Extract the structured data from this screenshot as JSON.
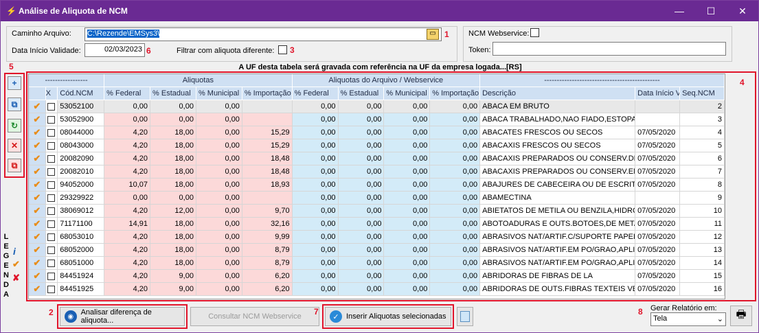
{
  "window": {
    "title": "Análise de Aliquota de NCM",
    "controls": [
      "—",
      "☐",
      "✕"
    ]
  },
  "form": {
    "caminho_label": "Caminho Arquivo:",
    "caminho_value": "C:\\Rezende\\EMSys3\\",
    "data_label": "Data Início Validade:",
    "data_value": "02/03/2023",
    "filtrar_label": "Filtrar com aliquota diferente:",
    "ncm_ws_label": "NCM Webservice:",
    "token_label": "Token:",
    "token_value": ""
  },
  "notice": "A UF desta tabela será gravada com referência na UF da empresa logada...[RS]",
  "markers": {
    "m1": "1",
    "m2": "2",
    "m3": "3",
    "m4": "4",
    "m5": "5",
    "m6": "6",
    "m7": "7",
    "m8": "8"
  },
  "grid": {
    "group_headers": [
      "-----------------",
      "Aliquotas",
      "Aliquotas do Arquivo / Webservice",
      "----------------------------------------------"
    ],
    "columns": [
      "",
      "X",
      "Cód.NCM",
      "% Federal",
      "% Estadual",
      "% Municipal",
      "% Importação",
      "% Federal",
      "% Estadual",
      "% Municipal",
      "% Importação",
      "Descrição",
      "Data Início Va",
      "Seq.NCM"
    ],
    "rows": [
      {
        "ncm": "53052100",
        "f": "0,00",
        "e": "0,00",
        "m": "0,00",
        "i": "",
        "wf": "0,00",
        "we": "0,00",
        "wm": "0,00",
        "wi": "0,00",
        "desc": "ABACA EM BRUTO",
        "date": "",
        "seq": "2"
      },
      {
        "ncm": "53052900",
        "f": "0,00",
        "e": "0,00",
        "m": "0,00",
        "i": "",
        "wf": "0,00",
        "we": "0,00",
        "wm": "0,00",
        "wi": "0,00",
        "desc": "ABACA TRABALHADO,NAO FIADO,ESTOPAS E",
        "date": "",
        "seq": "3"
      },
      {
        "ncm": "08044000",
        "f": "4,20",
        "e": "18,00",
        "m": "0,00",
        "i": "15,29",
        "wf": "0,00",
        "we": "0,00",
        "wm": "0,00",
        "wi": "0,00",
        "desc": "ABACATES FRESCOS OU SECOS",
        "date": "07/05/2020",
        "seq": "4"
      },
      {
        "ncm": "08043000",
        "f": "4,20",
        "e": "18,00",
        "m": "0,00",
        "i": "15,29",
        "wf": "0,00",
        "we": "0,00",
        "wm": "0,00",
        "wi": "0,00",
        "desc": "ABACAXIS FRESCOS OU SECOS",
        "date": "07/05/2020",
        "seq": "5"
      },
      {
        "ncm": "20082090",
        "f": "4,20",
        "e": "18,00",
        "m": "0,00",
        "i": "18,48",
        "wf": "0,00",
        "we": "0,00",
        "wm": "0,00",
        "wi": "0,00",
        "desc": "ABACAXIS PREPARADOS OU CONSERV.DE OUT",
        "date": "07/05/2020",
        "seq": "6"
      },
      {
        "ncm": "20082010",
        "f": "4,20",
        "e": "18,00",
        "m": "0,00",
        "i": "18,48",
        "wf": "0,00",
        "we": "0,00",
        "wm": "0,00",
        "wi": "0,00",
        "desc": "ABACAXIS PREPARADOS OU CONSERV.EM AGU",
        "date": "07/05/2020",
        "seq": "7"
      },
      {
        "ncm": "94052000",
        "f": "10,07",
        "e": "18,00",
        "m": "0,00",
        "i": "18,93",
        "wf": "0,00",
        "we": "0,00",
        "wm": "0,00",
        "wi": "0,00",
        "desc": "ABAJURES DE CABECEIRA OU DE ESCRITORIC",
        "date": "07/05/2020",
        "seq": "8"
      },
      {
        "ncm": "29329922",
        "f": "0,00",
        "e": "0,00",
        "m": "0,00",
        "i": "",
        "wf": "0,00",
        "we": "0,00",
        "wm": "0,00",
        "wi": "0,00",
        "desc": "ABAMECTINA",
        "date": "",
        "seq": "9"
      },
      {
        "ncm": "38069012",
        "f": "4,20",
        "e": "12,00",
        "m": "0,00",
        "i": "9,70",
        "wf": "0,00",
        "we": "0,00",
        "wm": "0,00",
        "wi": "0,00",
        "desc": "ABIETATOS DE METILA OU BENZILA,HIDROABI",
        "date": "07/05/2020",
        "seq": "10"
      },
      {
        "ncm": "71171100",
        "f": "14,91",
        "e": "18,00",
        "m": "0,00",
        "i": "32,16",
        "wf": "0,00",
        "we": "0,00",
        "wm": "0,00",
        "wi": "0,00",
        "desc": "ABOTOADURAS E OUTS.BOTOES,DE METAIS C",
        "date": "07/05/2020",
        "seq": "11"
      },
      {
        "ncm": "68053010",
        "f": "4,20",
        "e": "18,00",
        "m": "0,00",
        "i": "9,99",
        "wf": "0,00",
        "we": "0,00",
        "wm": "0,00",
        "wi": "0,00",
        "desc": "ABRASIVOS NAT/ARTIF.C/SUPORTE PAPEL/CA",
        "date": "07/05/2020",
        "seq": "12"
      },
      {
        "ncm": "68052000",
        "f": "4,20",
        "e": "18,00",
        "m": "0,00",
        "i": "8,79",
        "wf": "0,00",
        "we": "0,00",
        "wm": "0,00",
        "wi": "0,00",
        "desc": "ABRASIVOS NAT/ARTIF.EM PO/GRAO,APLIC.E",
        "date": "07/05/2020",
        "seq": "13"
      },
      {
        "ncm": "68051000",
        "f": "4,20",
        "e": "18,00",
        "m": "0,00",
        "i": "8,79",
        "wf": "0,00",
        "we": "0,00",
        "wm": "0,00",
        "wi": "0,00",
        "desc": "ABRASIVOS NAT/ARTIF.EM PO/GRAO,APLIC.E",
        "date": "07/05/2020",
        "seq": "14"
      },
      {
        "ncm": "84451924",
        "f": "4,20",
        "e": "9,00",
        "m": "0,00",
        "i": "6,20",
        "wf": "0,00",
        "we": "0,00",
        "wm": "0,00",
        "wi": "0,00",
        "desc": "ABRIDORAS DE FIBRAS DE LA",
        "date": "07/05/2020",
        "seq": "15"
      },
      {
        "ncm": "84451925",
        "f": "4,20",
        "e": "9,00",
        "m": "0,00",
        "i": "6,20",
        "wf": "0,00",
        "we": "0,00",
        "wm": "0,00",
        "wi": "0,00",
        "desc": "ABRIDORAS DE OUTS.FIBRAS TEXTEIS VEGETA",
        "date": "07/05/2020",
        "seq": "16"
      }
    ]
  },
  "legend": [
    "L",
    "E",
    "G",
    "E",
    "N",
    "D",
    "A"
  ],
  "buttons": {
    "analisar": "Analisar diferença de aliquota...",
    "consultar": "Consultar NCM Webservice",
    "inserir": "Inserir Aliquotas selecionadas"
  },
  "report": {
    "label": "Gerar Relatório em:",
    "value": "Tela"
  },
  "colors": {
    "title_bg": "#6a2a93",
    "accent_red": "#e0142a",
    "pink": "#fcd9d9",
    "light_blue": "#d3ebf8"
  }
}
